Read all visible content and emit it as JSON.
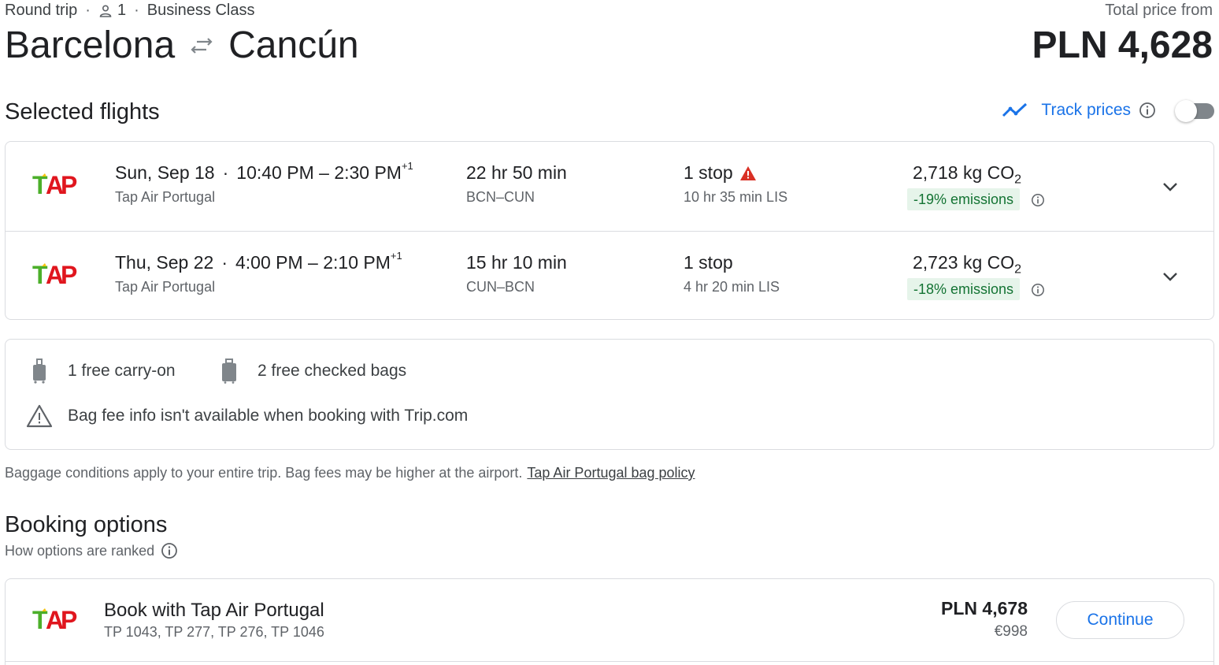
{
  "header": {
    "trip_type": "Round trip",
    "passengers": "1",
    "cabin_class": "Business Class",
    "origin": "Barcelona",
    "destination": "Cancún",
    "total_label": "Total price from",
    "total_price": "PLN 4,628"
  },
  "selected_flights": {
    "title": "Selected flights",
    "track_prices_label": "Track prices",
    "track_prices_enabled": false,
    "flights": [
      {
        "date": "Sun, Sep 18",
        "depart": "10:40 PM",
        "arrive": "2:30 PM",
        "day_offset": "+1",
        "airline": "Tap Air Portugal",
        "duration": "22 hr 50 min",
        "route": "BCN–CUN",
        "stops": "1 stop",
        "stop_warning": true,
        "layover": "10 hr 35 min LIS",
        "co2_value": "2,718 kg CO",
        "co2_sub": "2",
        "emissions": "-19% emissions"
      },
      {
        "date": "Thu, Sep 22",
        "depart": "4:00 PM",
        "arrive": "2:10 PM",
        "day_offset": "+1",
        "airline": "Tap Air Portugal",
        "duration": "15 hr 10 min",
        "route": "CUN–BCN",
        "stops": "1 stop",
        "stop_warning": false,
        "layover": "4 hr 20 min LIS",
        "co2_value": "2,723 kg CO",
        "co2_sub": "2",
        "emissions": "-18% emissions"
      }
    ]
  },
  "baggage": {
    "carry_on": "1 free carry-on",
    "checked": "2 free checked bags",
    "warning": "Bag fee info isn't available when booking with Trip.com",
    "note": "Baggage conditions apply to your entire trip. Bag fees may be higher at the airport.",
    "policy_link": "Tap Air Portugal bag policy"
  },
  "booking": {
    "title": "Booking options",
    "ranked_label": "How options are ranked",
    "options": [
      {
        "name": "Book with Tap Air Portugal",
        "flights": "TP 1043, TP 277, TP 276, TP 1046",
        "price": "PLN 4,678",
        "price_eur": "€998",
        "button": "Continue"
      }
    ]
  },
  "colors": {
    "accent": "#1a73e8",
    "emissions_bg": "#e6f4ea",
    "emissions_text": "#137333",
    "warning": "#d93025",
    "tap_green": "#4caf2a",
    "tap_red": "#e0161e"
  },
  "icons": [
    "person-icon",
    "swap-arrows-icon",
    "trend-line-icon",
    "info-icon",
    "warning-icon",
    "chevron-down-icon",
    "carry-on-bag-icon",
    "checked-bag-icon",
    "tap-logo"
  ]
}
